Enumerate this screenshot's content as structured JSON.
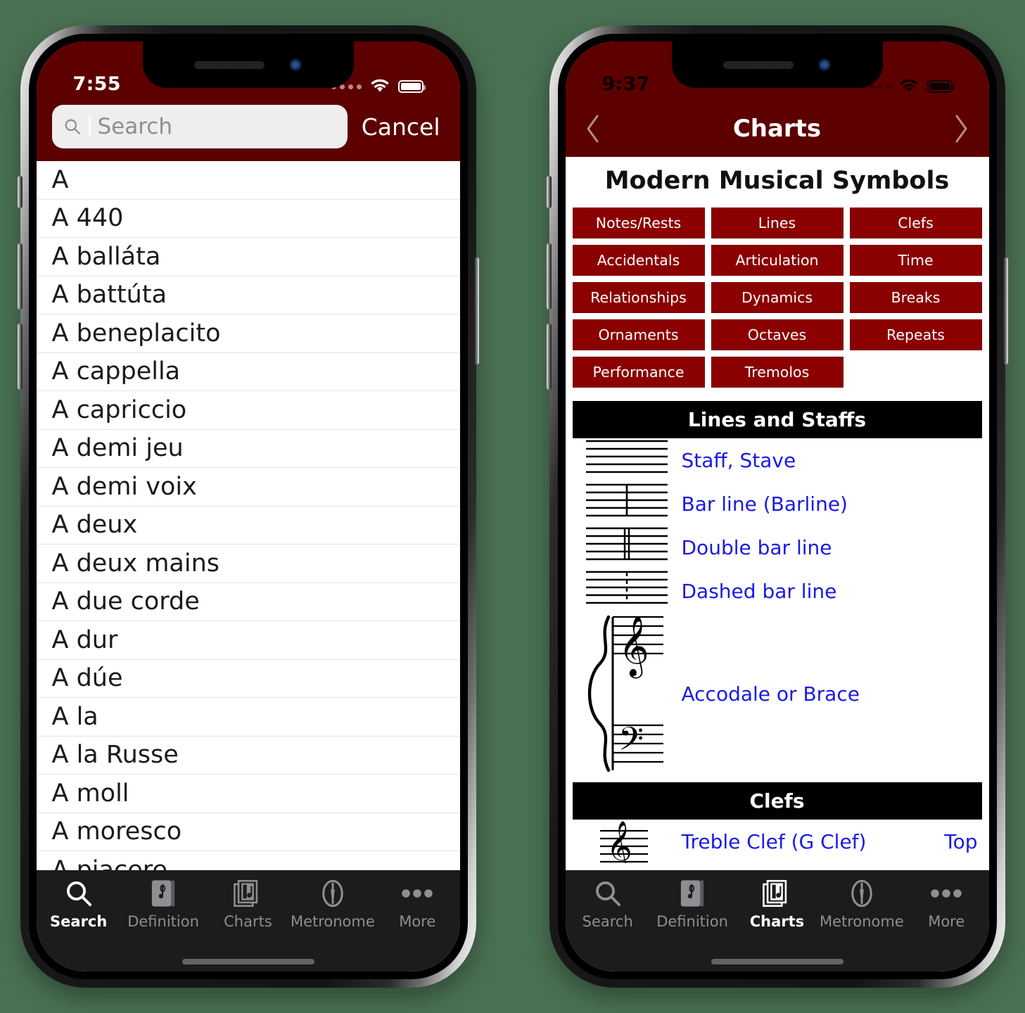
{
  "background_color": "#4a7153",
  "theme": {
    "header_red": "#5c0000",
    "button_red": "#8b0000",
    "section_header_black": "#000000",
    "link_blue": "#1a1ae6",
    "tabbar_dark": "#1c1c1c",
    "tab_inactive": "#8e8e93"
  },
  "left_phone": {
    "status_bar": {
      "time": "7:55",
      "cellular_icon": "signal-dots-icon",
      "wifi_icon": "wifi-icon",
      "battery_icon": "battery-full-icon",
      "text_color": "#ffffff"
    },
    "search": {
      "placeholder": "Search",
      "value": "",
      "icon": "search-icon",
      "cancel_label": "Cancel"
    },
    "list_items": [
      "A",
      "A 440",
      "A balláta",
      "A battúta",
      "A beneplacito",
      "A cappella",
      "A capriccio",
      "A demi jeu",
      "A demi voix",
      "A deux",
      "A deux mains",
      "A due corde",
      "A dur",
      "A dúe",
      "A la",
      "A la Russe",
      "A moll",
      "A moresco",
      "A piacere"
    ],
    "tabs": [
      {
        "label": "Search",
        "icon": "search-icon",
        "active": true
      },
      {
        "label": "Definition",
        "icon": "book-music-icon",
        "active": false
      },
      {
        "label": "Charts",
        "icon": "charts-icon",
        "active": false
      },
      {
        "label": "Metronome",
        "icon": "metronome-icon",
        "active": false
      },
      {
        "label": "More",
        "icon": "ellipsis-icon",
        "active": false
      }
    ]
  },
  "right_phone": {
    "status_bar": {
      "time": "9:37",
      "cellular_icon": "signal-dots-icon",
      "wifi_icon": "wifi-icon",
      "battery_icon": "battery-full-icon",
      "text_color": "#0d0000"
    },
    "navbar": {
      "back_icon": "chevron-left-icon",
      "title": "Charts",
      "forward_icon": "chevron-right-icon"
    },
    "page_title": "Modern Musical Symbols",
    "category_buttons": [
      "Notes/Rests",
      "Lines",
      "Clefs",
      "Accidentals",
      "Articulation",
      "Time",
      "Relationships",
      "Dynamics",
      "Breaks",
      "Ornaments",
      "Octaves",
      "Repeats",
      "Performance",
      "Tremolos",
      ""
    ],
    "sections": [
      {
        "heading": "Lines and Staffs",
        "rows": [
          {
            "symbol": "staff-icon",
            "label": "Staff, Stave",
            "note": ""
          },
          {
            "symbol": "barline-icon",
            "label": "Bar line (Barline)",
            "note": ""
          },
          {
            "symbol": "double-barline-icon",
            "label": "Double bar line",
            "note": ""
          },
          {
            "symbol": "dashed-barline-icon",
            "label": "Dashed bar line",
            "note": ""
          },
          {
            "symbol": "brace-grand-staff-icon",
            "label": "Accodale or Brace",
            "note": ""
          }
        ]
      },
      {
        "heading": "Clefs",
        "rows": [
          {
            "symbol": "treble-clef-icon",
            "label": "Treble Clef (G Clef)",
            "note": "Top"
          }
        ]
      }
    ],
    "tabs": [
      {
        "label": "Search",
        "icon": "search-icon",
        "active": false
      },
      {
        "label": "Definition",
        "icon": "book-music-icon",
        "active": false
      },
      {
        "label": "Charts",
        "icon": "charts-icon",
        "active": true
      },
      {
        "label": "Metronome",
        "icon": "metronome-icon",
        "active": false
      },
      {
        "label": "More",
        "icon": "ellipsis-icon",
        "active": false
      }
    ]
  }
}
